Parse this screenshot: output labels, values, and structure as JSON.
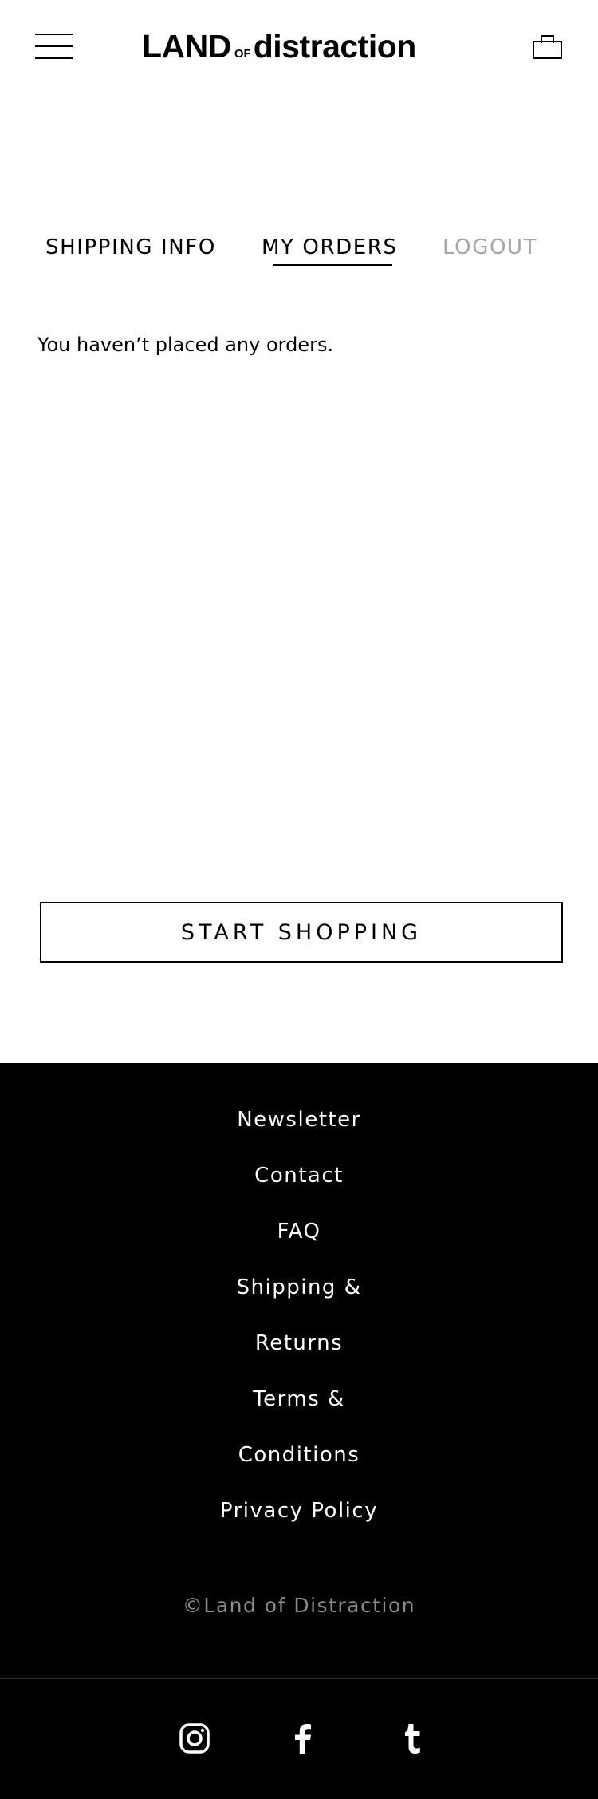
{
  "header": {
    "logo_land": "LAND",
    "logo_of": "OF",
    "logo_distraction": "distraction",
    "menu_icon": "hamburger-icon",
    "bag_icon": "shopping-bag-icon"
  },
  "tabs": [
    {
      "label": "SHIPPING INFO",
      "active": false
    },
    {
      "label": "MY ORDERS",
      "active": true
    },
    {
      "label": "LOGOUT",
      "active": false
    }
  ],
  "orders": {
    "empty_message": "You haven’t placed any orders."
  },
  "cta": {
    "label": "START SHOPPING"
  },
  "footer": {
    "links": [
      "Newsletter",
      "Contact",
      "FAQ",
      "Shipping &",
      "Returns",
      "Terms &",
      "Conditions",
      "Privacy Policy"
    ],
    "copyright": "©Land of Distraction",
    "social": [
      "instagram-icon",
      "facebook-icon",
      "tumblr-icon"
    ]
  },
  "colors": {
    "background": "#ffffff",
    "text": "#000000",
    "inactive_tab": "#a6a6a6",
    "footer_background": "#000000",
    "footer_text": "#ffffff",
    "copyright_text": "#8c8c8c"
  }
}
